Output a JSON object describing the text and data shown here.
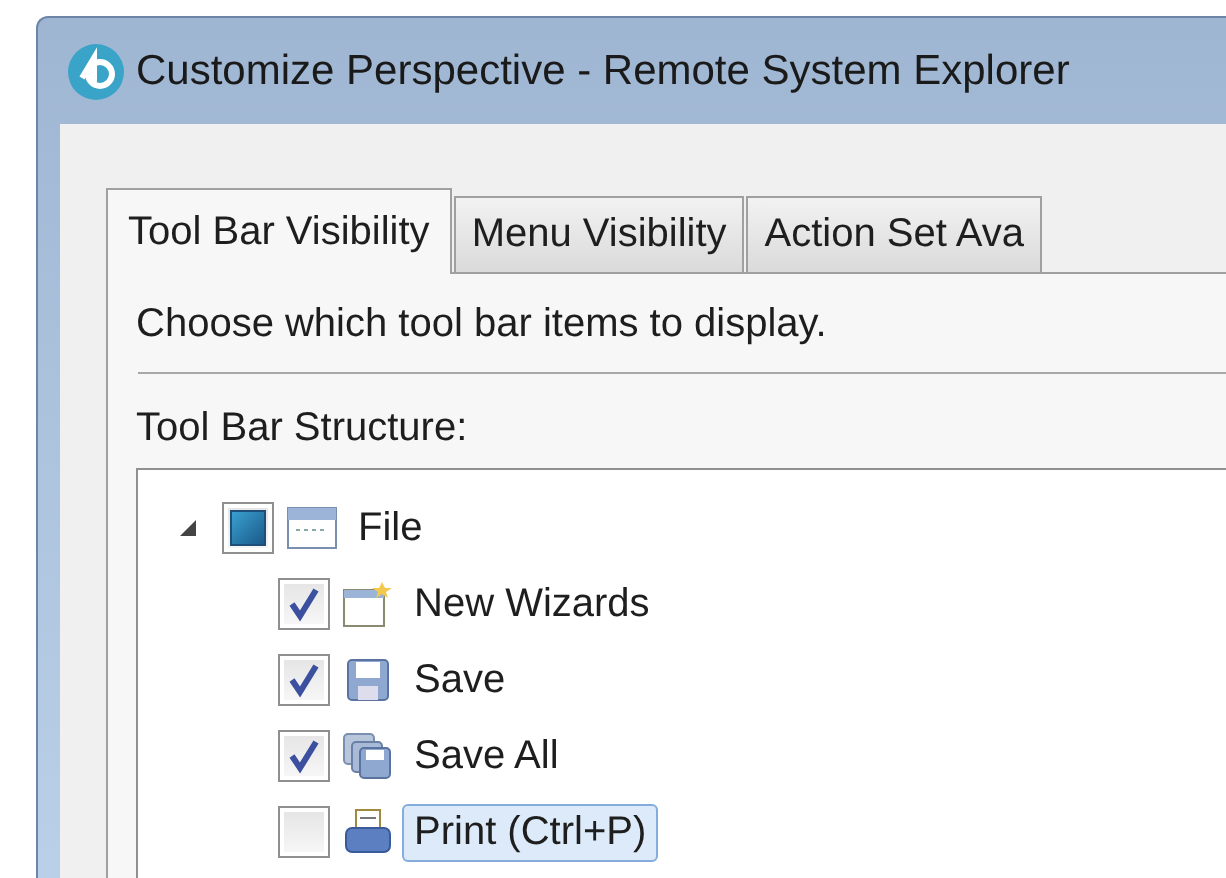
{
  "window": {
    "title": "Customize Perspective - Remote System Explorer"
  },
  "tabs": [
    {
      "label": "Tool Bar Visibility",
      "selected": true
    },
    {
      "label": "Menu Visibility",
      "selected": false
    },
    {
      "label": "Action Set Ava",
      "selected": false
    }
  ],
  "description": "Choose which tool bar items to display.",
  "tree": {
    "label": "Tool Bar Structure:",
    "items": [
      {
        "label": "File",
        "expanded": true,
        "checked": true,
        "grayed": true,
        "selected": false,
        "children": [
          {
            "label": "New Wizards",
            "checked": true,
            "selected": false
          },
          {
            "label": "Save",
            "checked": true,
            "selected": false
          },
          {
            "label": "Save All",
            "checked": true,
            "selected": false
          },
          {
            "label": "Print (Ctrl+P)",
            "checked": false,
            "selected": true
          }
        ]
      }
    ]
  }
}
